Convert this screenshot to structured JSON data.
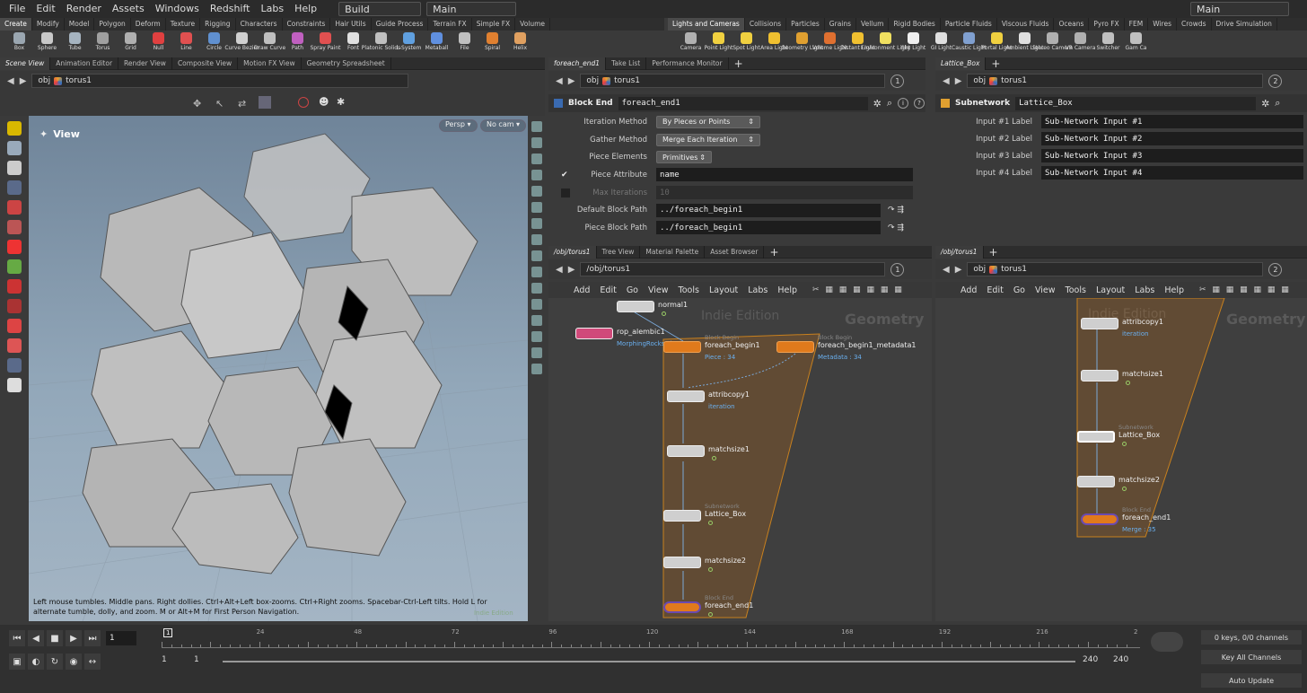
{
  "menubar": {
    "items": [
      "File",
      "Edit",
      "Render",
      "Assets",
      "Windows",
      "Redshift",
      "Labs",
      "Help"
    ],
    "desktop": "Build",
    "main": "Main",
    "right_main": "Main"
  },
  "shelf_left": {
    "tabs": [
      "Create",
      "Modify",
      "Model",
      "Polygon",
      "Deform",
      "Texture",
      "Rigging",
      "Characters",
      "Constraints",
      "Hair Utils",
      "Guide Process",
      "Terrain FX",
      "Simple FX",
      "Volume"
    ],
    "tools": [
      {
        "label": "Box",
        "icon": "box-icon",
        "color": "#9aa6b0"
      },
      {
        "label": "Sphere",
        "icon": "sphere-icon",
        "color": "#c9c9c9"
      },
      {
        "label": "Tube",
        "icon": "tube-icon",
        "color": "#a6b4c0"
      },
      {
        "label": "Torus",
        "icon": "torus-icon",
        "color": "#a0a0a0"
      },
      {
        "label": "Grid",
        "icon": "grid-icon",
        "color": "#b0b0b0"
      },
      {
        "label": "Null",
        "icon": "null-icon",
        "color": "#e04040"
      },
      {
        "label": "Line",
        "icon": "line-icon",
        "color": "#e05050"
      },
      {
        "label": "Circle",
        "icon": "circle-icon",
        "color": "#6090d0"
      },
      {
        "label": "Curve Bezier",
        "icon": "curve-bezier-icon",
        "color": "#d0d0d0"
      },
      {
        "label": "Draw Curve",
        "icon": "draw-curve-icon",
        "color": "#c0c0c0"
      },
      {
        "label": "Path",
        "icon": "path-icon",
        "color": "#c060c0"
      },
      {
        "label": "Spray Paint",
        "icon": "spray-paint-icon",
        "color": "#e05050"
      },
      {
        "label": "Font",
        "icon": "font-icon",
        "color": "#e0e0e0"
      },
      {
        "label": "Platonic Solids",
        "icon": "platonic-solids-icon",
        "color": "#c0c0c0"
      },
      {
        "label": "L-System",
        "icon": "l-system-icon",
        "color": "#60a0e0"
      },
      {
        "label": "Metaball",
        "icon": "metaball-icon",
        "color": "#6090e0"
      },
      {
        "label": "File",
        "icon": "file-icon",
        "color": "#c0c0c0"
      },
      {
        "label": "Spiral",
        "icon": "spiral-icon",
        "color": "#e08030"
      },
      {
        "label": "Helix",
        "icon": "helix-icon",
        "color": "#e0a060"
      }
    ]
  },
  "shelf_right": {
    "tabs": [
      "Lights and Cameras",
      "Collisions",
      "Particles",
      "Grains",
      "Vellum",
      "Rigid Bodies",
      "Particle Fluids",
      "Viscous Fluids",
      "Oceans",
      "Pyro FX",
      "FEM",
      "Wires",
      "Crowds",
      "Drive Simulation"
    ],
    "tools": [
      {
        "label": "Camera",
        "icon": "camera-icon",
        "color": "#b0b0b0"
      },
      {
        "label": "Point Light",
        "icon": "point-light-icon",
        "color": "#f0d040"
      },
      {
        "label": "Spot Light",
        "icon": "spot-light-icon",
        "color": "#f0d040"
      },
      {
        "label": "Area Light",
        "icon": "area-light-icon",
        "color": "#f0c030"
      },
      {
        "label": "Geometry Light",
        "icon": "geometry-light-icon",
        "color": "#e0a030"
      },
      {
        "label": "Volume Light",
        "icon": "volume-light-icon",
        "color": "#e07030"
      },
      {
        "label": "Distant Light",
        "icon": "distant-light-icon",
        "color": "#f0c030"
      },
      {
        "label": "Environment Light",
        "icon": "environment-light-icon",
        "color": "#f0e060"
      },
      {
        "label": "Sky Light",
        "icon": "sky-light-icon",
        "color": "#f0f0f0"
      },
      {
        "label": "GI Light",
        "icon": "gi-light-icon",
        "color": "#e0e0e0"
      },
      {
        "label": "Caustic Light",
        "icon": "caustic-light-icon",
        "color": "#80a0d0"
      },
      {
        "label": "Portal Light",
        "icon": "portal-light-icon",
        "color": "#f0d040"
      },
      {
        "label": "Ambient Light",
        "icon": "ambient-light-icon",
        "color": "#e0e0e0"
      },
      {
        "label": "Stereo Camera",
        "icon": "stereo-camera-icon",
        "color": "#b0b0b0"
      },
      {
        "label": "VR Camera",
        "icon": "vr-camera-icon",
        "color": "#b0b0b0"
      },
      {
        "label": "Switcher",
        "icon": "switcher-icon",
        "color": "#c0c0c0"
      },
      {
        "label": "Gam Ca",
        "icon": "gamepad-camera-icon",
        "color": "#c0c0c0"
      }
    ]
  },
  "viewer": {
    "tabs": [
      "Scene View",
      "Animation Editor",
      "Render View",
      "Composite View",
      "Motion FX View",
      "Geometry Spreadsheet"
    ],
    "path_root": "obj",
    "path_node": "torus1",
    "view_label": "View",
    "persp": "Persp",
    "cam": "No cam",
    "help": "Left mouse tumbles. Middle pans. Right dollies. Ctrl+Alt+Left box-zooms. Ctrl+Right zooms. Spacebar-Ctrl-Left tilts. Hold L for alternate tumble, dolly, and zoom. M or Alt+M for First Person Navigation.",
    "edition": "Indie Edition"
  },
  "params_mid": {
    "tabs": [
      "foreach_end1",
      "Take List",
      "Performance Monitor"
    ],
    "path_root": "obj",
    "path_node": "torus1",
    "pin": "1",
    "node_type": "Block End",
    "node_name": "foreach_end1",
    "rows": [
      {
        "label": "Iteration Method",
        "kind": "drop",
        "value": "By Pieces or Points"
      },
      {
        "label": "Gather Method",
        "kind": "drop",
        "value": "Merge Each Iteration"
      },
      {
        "label": "Piece Elements",
        "kind": "drop",
        "value": "Primitives"
      },
      {
        "label": "Piece Attribute",
        "kind": "field",
        "value": "name",
        "check": "✔"
      },
      {
        "label": "Max Iterations",
        "kind": "field",
        "value": "10",
        "dim": true
      },
      {
        "label": "Default Block Path",
        "kind": "field",
        "value": "../foreach_begin1"
      },
      {
        "label": "Piece Block Path",
        "kind": "field",
        "value": "../foreach_begin1"
      }
    ]
  },
  "params_right": {
    "tabs": [
      "Lattice_Box"
    ],
    "path_root": "obj",
    "path_node": "torus1",
    "pin": "2",
    "node_type": "Subnetwork",
    "node_name": "Lattice_Box",
    "rows": [
      {
        "label": "Input #1 Label",
        "value": "Sub-Network Input #1"
      },
      {
        "label": "Input #2 Label",
        "value": "Sub-Network Input #2"
      },
      {
        "label": "Input #3 Label",
        "value": "Sub-Network Input #3"
      },
      {
        "label": "Input #4 Label",
        "value": "Sub-Network Input #4"
      }
    ]
  },
  "net_mid": {
    "tabs": [
      "/obj/torus1",
      "Tree View",
      "Material Palette",
      "Asset Browser"
    ],
    "path": "/obj/torus1",
    "pin": "1",
    "menu": [
      "Add",
      "Edit",
      "Go",
      "View",
      "Tools",
      "Layout",
      "Labs",
      "Help"
    ],
    "watermark_edition": "Indie Edition",
    "watermark_ctx": "Geometry",
    "nodes": [
      {
        "name": "normal1",
        "sub": "",
        "stat": ""
      },
      {
        "name": "rop_alembic1",
        "sub": "",
        "stat": "MorphingRocks.abc"
      },
      {
        "name": "foreach_begin1",
        "sub": "Block Begin",
        "stat": "Piece : 34"
      },
      {
        "name": "foreach_begin1_metadata1",
        "sub": "Block Begin",
        "stat": "Metadata : 34"
      },
      {
        "name": "attribcopy1",
        "sub": "",
        "stat": "iteration"
      },
      {
        "name": "matchsize1",
        "sub": "",
        "stat": ""
      },
      {
        "name": "Lattice_Box",
        "sub": "Subnetwork",
        "stat": ""
      },
      {
        "name": "matchsize2",
        "sub": "",
        "stat": ""
      },
      {
        "name": "foreach_end1",
        "sub": "Block End",
        "stat": ""
      }
    ]
  },
  "net_right": {
    "tabs": [
      "/obj/torus1"
    ],
    "path_root": "obj",
    "path_node": "torus1",
    "pin": "2",
    "menu": [
      "Add",
      "Edit",
      "Go",
      "View",
      "Tools",
      "Layout",
      "Labs",
      "Help"
    ],
    "watermark_edition": "Indie Edition",
    "watermark_ctx": "Geometry",
    "nodes": [
      {
        "name": "attribcopy1",
        "sub": "",
        "stat": "iteration"
      },
      {
        "name": "matchsize1",
        "sub": "",
        "stat": ""
      },
      {
        "name": "Lattice_Box",
        "sub": "Subnetwork",
        "stat": ""
      },
      {
        "name": "matchsize2",
        "sub": "",
        "stat": ""
      },
      {
        "name": "foreach_end1",
        "sub": "Block End",
        "stat": "Merge : 35"
      }
    ]
  },
  "timeline": {
    "frame": "1",
    "ticks": [
      "1",
      "24",
      "48",
      "72",
      "96",
      "120",
      "144",
      "168",
      "192",
      "216",
      "2"
    ],
    "start": "1",
    "start2": "1",
    "end": "240",
    "end2": "240",
    "keys": "0 keys, 0/0 channels",
    "channels": "Key All Channels",
    "update": "Auto Update"
  }
}
